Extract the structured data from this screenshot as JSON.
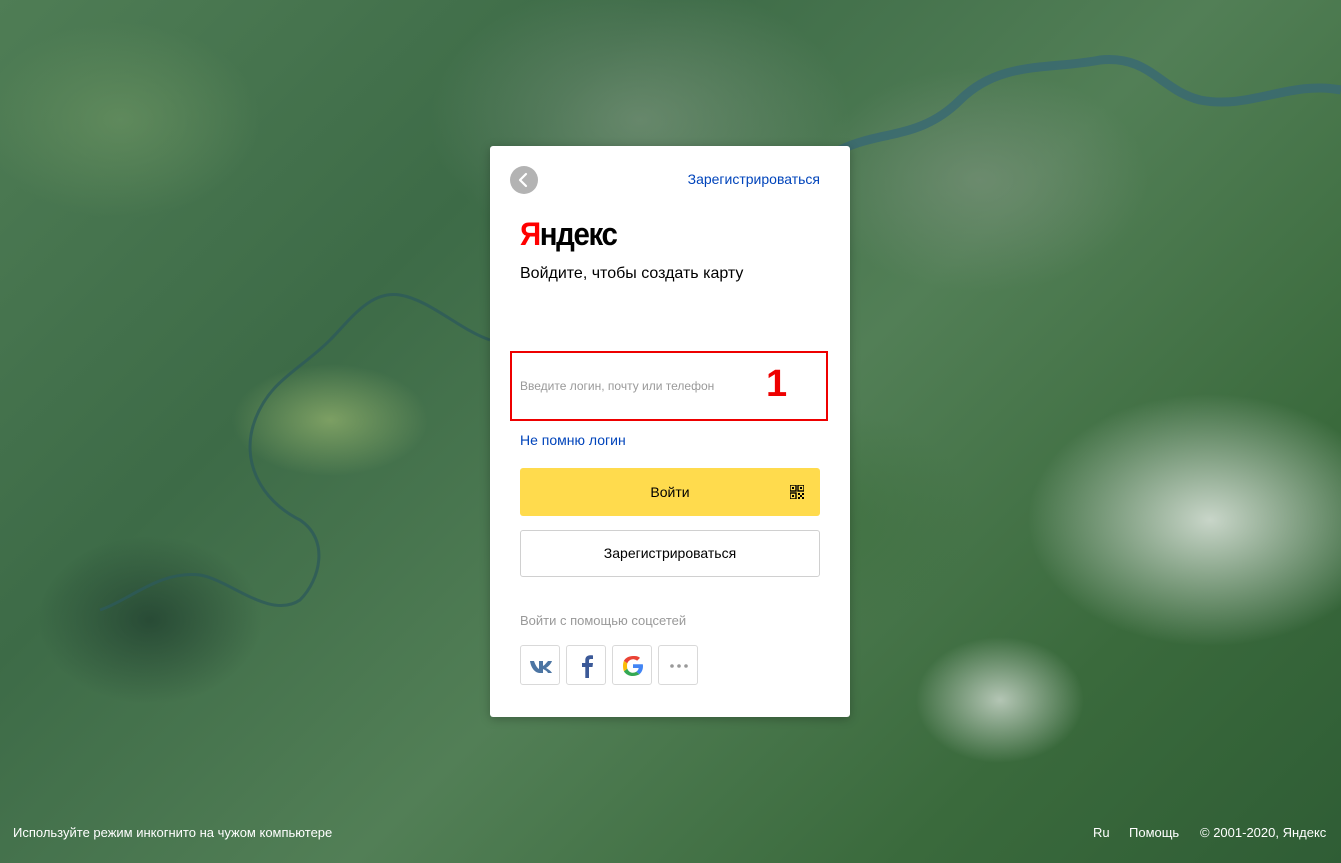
{
  "header": {
    "back_icon": "chevron-left-icon",
    "register_link": "Зарегистрироваться"
  },
  "logo": {
    "first_letter": "Я",
    "rest": "ндекс"
  },
  "subtitle": "Войдите, чтобы создать карту",
  "login": {
    "placeholder": "Введите логин, почту или телефон",
    "value": "",
    "annotation": "1",
    "highlight_color": "#ee0000"
  },
  "forgot_login": "Не помню логин",
  "signin_button": {
    "label": "Войти",
    "icon": "qr-code-icon",
    "color": "#ffdb4d"
  },
  "register_button": "Зарегистрироваться",
  "social": {
    "label": "Войти с помощью соцсетей",
    "items": [
      {
        "icon": "vk-icon"
      },
      {
        "icon": "facebook-icon"
      },
      {
        "icon": "google-icon"
      },
      {
        "icon": "more-icon"
      }
    ]
  },
  "footer": {
    "incognito_hint": "Используйте режим инкогнито на чужом компьютере",
    "language": "Ru",
    "help": "Помощь",
    "copyright": "© 2001-2020, Яндекс"
  },
  "colors": {
    "link": "#0044bb",
    "logo_red": "#ff0000"
  }
}
